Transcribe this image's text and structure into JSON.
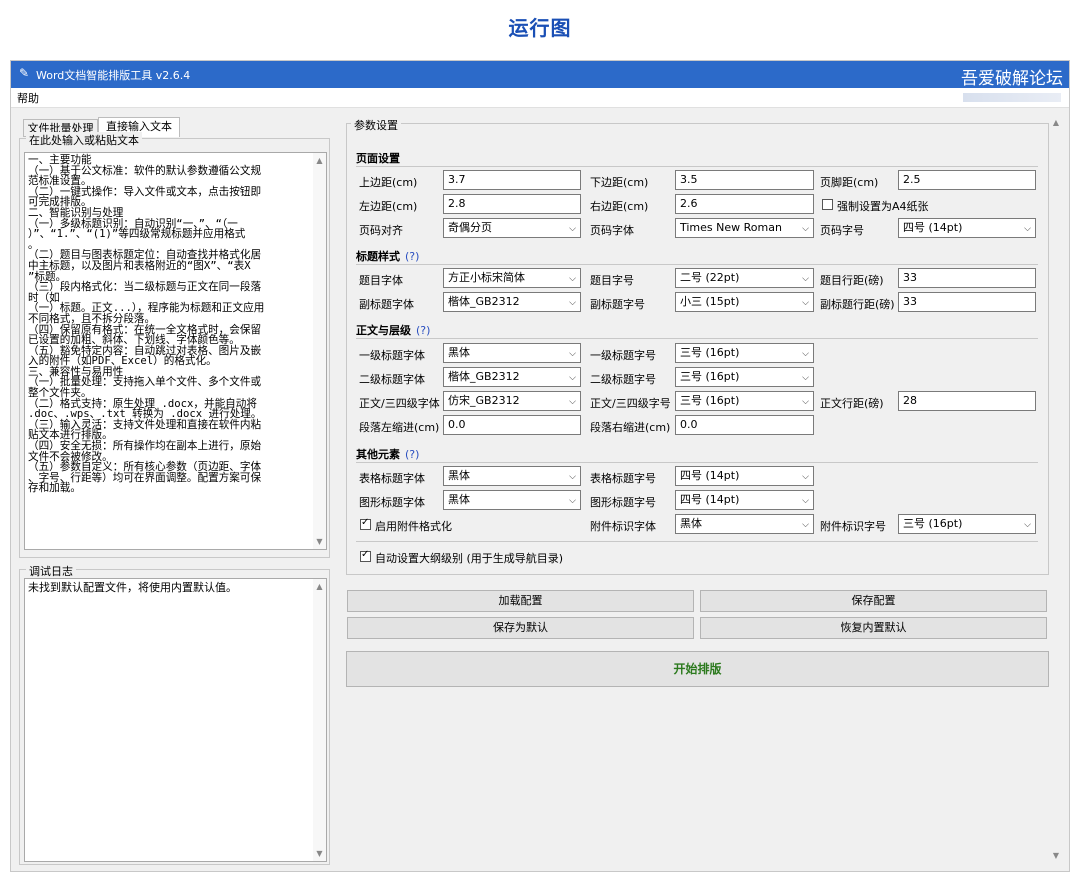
{
  "caption": "运行图",
  "window": {
    "icon": "✎",
    "title": "Word文档智能排版工具 v2.6.4",
    "brand": "吾爱破解论坛"
  },
  "menu": {
    "help": "帮助"
  },
  "tabs": [
    {
      "label": "文件批量处理"
    },
    {
      "label": "直接输入文本"
    }
  ],
  "input_group": {
    "title": "在此处输入或粘贴文本",
    "lines": [
      "一、主要功能",
      "（一）基于公文标准：软件的默认参数遵循公文规",
      "范标准设置。",
      "（二）一键式操作：导入文件或文本，点击按钮即",
      "可完成排版。",
      "二、智能识别与处理",
      "（一）多级标题识别：自动识别“一、”、“（一",
      "）”、“1.”、“(1)”等四级常规标题并应用格式",
      "。",
      "（二）题目与图表标题定位：自动查找并格式化居",
      "中主标题，以及图片和表格附近的“图X”、“表X",
      "”标题。",
      "（三）段内格式化：当二级标题与正文在同一段落",
      "时（如",
      "（一）标题。正文...），程序能为标题和正文应用",
      "不同格式，且不拆分段落。",
      "（四）保留原有格式：在统一全文格式时，会保留",
      "已设置的加粗、斜体、下划线、字体颜色等。",
      "（五）豁免特定内容：自动跳过对表格、图片及嵌",
      "入的附件（如PDF、Excel）的格式化。",
      "三、兼容性与易用性",
      "（一）批量处理：支持拖入单个文件、多个文件或",
      "整个文件夹。",
      "（二）格式支持：原生处理 .docx，并能自动将",
      ".doc、.wps、.txt 转换为 .docx 进行处理。",
      "（三）输入灵活：支持文件处理和直接在软件内粘",
      "贴文本进行排版。",
      "（四）安全无损：所有操作均在副本上进行，原始",
      "文件不会被修改。",
      "（五）参数自定义：所有核心参数（页边距、字体",
      "、字号、行距等）均可在界面调整。配置方案可保",
      "存和加载。"
    ]
  },
  "log_group": {
    "title": "调试日志",
    "lines": [
      "未找到默认配置文件，将使用内置默认值。"
    ]
  },
  "params": {
    "title": "参数设置",
    "page": {
      "title": "页面设置",
      "top_margin_label": "上边距(cm)",
      "top_margin": "3.7",
      "bottom_margin_label": "下边距(cm)",
      "bottom_margin": "3.5",
      "footer_label": "页脚距(cm)",
      "footer": "2.5",
      "left_margin_label": "左边距(cm)",
      "left_margin": "2.8",
      "right_margin_label": "右边距(cm)",
      "right_margin": "2.6",
      "force_a4_label": "强制设置为A4纸张",
      "align_label": "页码对齐",
      "align": "奇偶分页",
      "font_label": "页码字体",
      "font": "Times New Roman",
      "size_label": "页码字号",
      "size": "四号 (14pt)"
    },
    "title_style": {
      "title": "标题样式",
      "help": "(?)",
      "title_font_label": "题目字体",
      "title_font": "方正小标宋简体",
      "title_size_label": "题目字号",
      "title_size": "二号 (22pt)",
      "title_spacing_label": "题目行距(磅)",
      "title_spacing": "33",
      "subtitle_font_label": "副标题字体",
      "subtitle_font": "楷体_GB2312",
      "subtitle_size_label": "副标题字号",
      "subtitle_size": "小三 (15pt)",
      "subtitle_spacing_label": "副标题行距(磅)",
      "subtitle_spacing": "33"
    },
    "body_style": {
      "title": "正文与层级",
      "help": "(?)",
      "h1_font_label": "一级标题字体",
      "h1_font": "黑体",
      "h1_size_label": "一级标题字号",
      "h1_size": "三号 (16pt)",
      "h2_font_label": "二级标题字体",
      "h2_font": "楷体_GB2312",
      "h2_size_label": "二级标题字号",
      "h2_size": "三号 (16pt)",
      "body_font_label": "正文/三四级字体",
      "body_font": "仿宋_GB2312",
      "body_size_label": "正文/三四级字号",
      "body_size": "三号 (16pt)",
      "body_spacing_label": "正文行距(磅)",
      "body_spacing": "28",
      "left_indent_label": "段落左缩进(cm)",
      "left_indent": "0.0",
      "right_indent_label": "段落右缩进(cm)",
      "right_indent": "0.0"
    },
    "other": {
      "title": "其他元素",
      "help": "(?)",
      "table_font_label": "表格标题字体",
      "table_font": "黑体",
      "table_size_label": "表格标题字号",
      "table_size": "四号 (14pt)",
      "figure_font_label": "图形标题字体",
      "figure_font": "黑体",
      "figure_size_label": "图形标题字号",
      "figure_size": "四号 (14pt)",
      "attach_enable_label": "启用附件格式化",
      "attach_font_label": "附件标识字体",
      "attach_font": "黑体",
      "attach_size_label": "附件标识字号",
      "attach_size": "三号 (16pt)"
    },
    "outline_label": "自动设置大纲级别 (用于生成导航目录)"
  },
  "buttons": {
    "load": "加载配置",
    "save": "保存配置",
    "save_default": "保存为默认",
    "restore_default": "恢复内置默认",
    "start": "开始排版"
  }
}
